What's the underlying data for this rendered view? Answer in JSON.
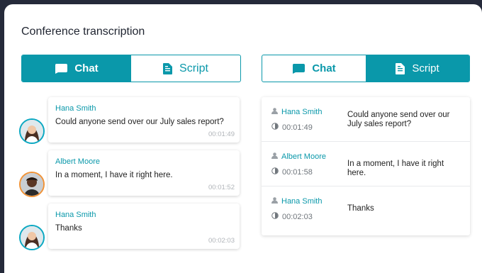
{
  "title": "Conference transcription",
  "colors": {
    "accent": "#0a98aa",
    "background": "#252a3a"
  },
  "tabs_left": {
    "chat_label": "Chat",
    "script_label": "Script",
    "active": "chat"
  },
  "tabs_right": {
    "chat_label": "Chat",
    "script_label": "Script",
    "active": "script"
  },
  "chat": [
    {
      "name": "Hana Smith",
      "message": "Could anyone send over our July sales report?",
      "time": "00:01:49",
      "avatar": "woman-avatar"
    },
    {
      "name": "Albert Moore",
      "message": "In a moment, I have it right here.",
      "time": "00:01:52",
      "avatar": "man-avatar"
    },
    {
      "name": "Hana Smith",
      "message": "Thanks",
      "time": "00:02:03",
      "avatar": "woman-avatar"
    }
  ],
  "script": [
    {
      "name": "Hana Smith",
      "time": "00:01:49",
      "message": "Could anyone send over our July sales report?"
    },
    {
      "name": "Albert Moore",
      "time": "00:01:58",
      "message": "In a moment, I have it right here."
    },
    {
      "name": "Hana Smith",
      "time": "00:02:03",
      "message": "Thanks"
    }
  ]
}
